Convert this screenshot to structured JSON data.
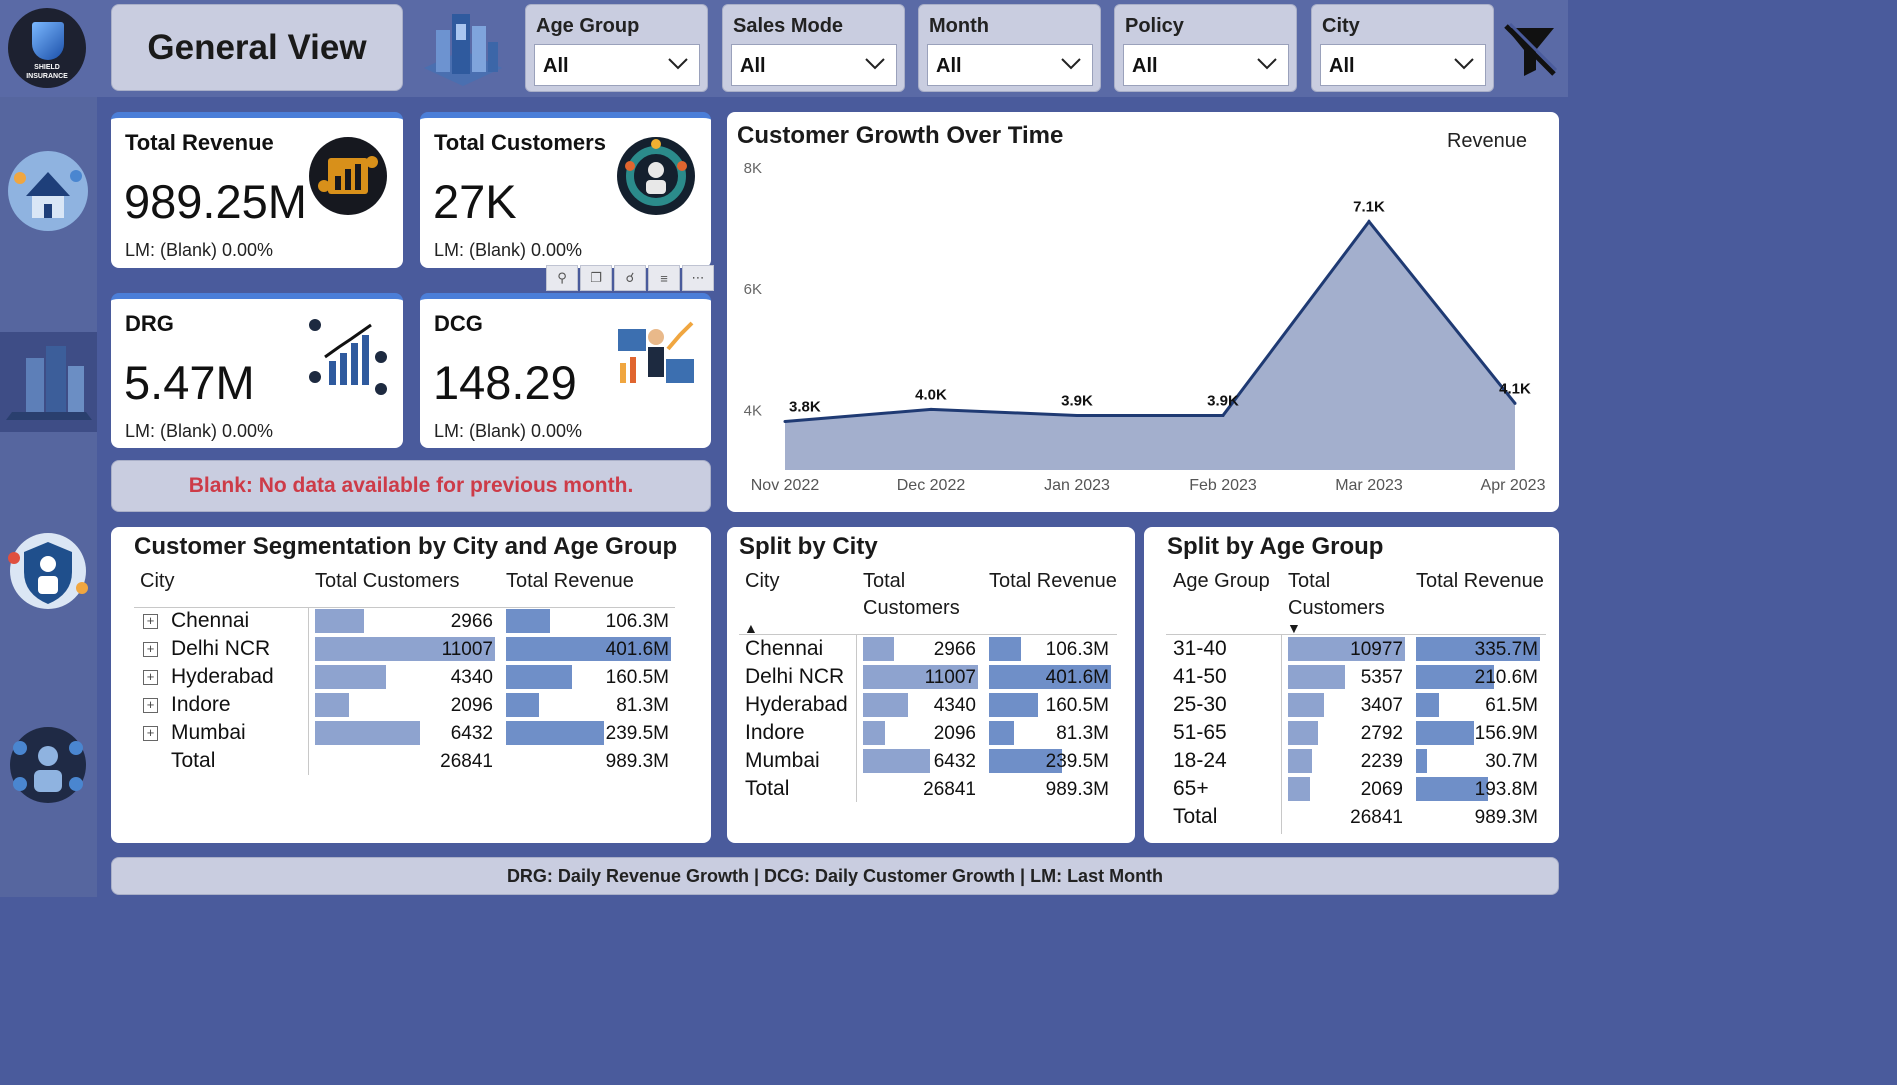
{
  "logo": {
    "line1": "SHIELD",
    "line2": "INSURANCE"
  },
  "header": {
    "title": "General View"
  },
  "slicers": [
    {
      "label": "Age Group",
      "value": "All"
    },
    {
      "label": "Sales Mode",
      "value": "All"
    },
    {
      "label": "Month",
      "value": "All"
    },
    {
      "label": "Policy",
      "value": "All"
    },
    {
      "label": "City",
      "value": "All"
    }
  ],
  "kpis": [
    {
      "title": "Total Revenue",
      "value": "989.25M",
      "lm": "LM: (Blank) 0.00%"
    },
    {
      "title": "Total Customers",
      "value": "27K",
      "lm": "LM: (Blank) 0.00%"
    },
    {
      "title": "DRG",
      "value": "5.47M",
      "lm": "LM: (Blank) 0.00%"
    },
    {
      "title": "DCG",
      "value": "148.29",
      "lm": "LM: (Blank) 0.00%"
    }
  ],
  "visual_toolbar": [
    "pin-icon",
    "copy-icon",
    "bell-icon",
    "filter-icon",
    "more-icon"
  ],
  "note": "Blank: No data available for previous month.",
  "footer": "DRG: Daily Revenue Growth | DCG: Daily Customer Growth | LM: Last Month",
  "chart_data": {
    "type": "area",
    "title": "Customer Growth Over Time",
    "legend": "Revenue",
    "legend_position": "top-right",
    "x": [
      "Nov 2022",
      "Dec 2022",
      "Jan 2023",
      "Feb 2023",
      "Mar 2023",
      "Apr 2023"
    ],
    "values": [
      3.8,
      4.0,
      3.9,
      3.9,
      7.1,
      4.1
    ],
    "data_labels": [
      "3.8K",
      "4.0K",
      "3.9K",
      "3.9K",
      "7.1K",
      "4.1K"
    ],
    "y_ticks": [
      "4K",
      "6K",
      "8K"
    ],
    "ylim": [
      3.0,
      8.0
    ],
    "color": "#1f3a73",
    "fill": "#a3afcd"
  },
  "segmentation": {
    "title": "Customer Segmentation by City and Age Group",
    "headers": [
      "City",
      "Total Customers",
      "Total Revenue"
    ],
    "max_customers": 11007,
    "max_revenue": 401.6,
    "rows": [
      {
        "city": "Chennai",
        "customers": "2966",
        "revenue": "106.3M",
        "c": 2966,
        "r": 106.3
      },
      {
        "city": "Delhi NCR",
        "customers": "11007",
        "revenue": "401.6M",
        "c": 11007,
        "r": 401.6
      },
      {
        "city": "Hyderabad",
        "customers": "4340",
        "revenue": "160.5M",
        "c": 4340,
        "r": 160.5
      },
      {
        "city": "Indore",
        "customers": "2096",
        "revenue": "81.3M",
        "c": 2096,
        "r": 81.3
      },
      {
        "city": "Mumbai",
        "customers": "6432",
        "revenue": "239.5M",
        "c": 6432,
        "r": 239.5
      }
    ],
    "total": {
      "label": "Total",
      "customers": "26841",
      "revenue": "989.3M"
    }
  },
  "split_city": {
    "title": "Split by City",
    "headers": [
      "City",
      "Total Customers",
      "Total Revenue"
    ],
    "max_customers": 11007,
    "max_revenue": 401.6,
    "rows": [
      {
        "city": "Chennai",
        "customers": "2966",
        "revenue": "106.3M",
        "c": 2966,
        "r": 106.3
      },
      {
        "city": "Delhi NCR",
        "customers": "11007",
        "revenue": "401.6M",
        "c": 11007,
        "r": 401.6
      },
      {
        "city": "Hyderabad",
        "customers": "4340",
        "revenue": "160.5M",
        "c": 4340,
        "r": 160.5
      },
      {
        "city": "Indore",
        "customers": "2096",
        "revenue": "81.3M",
        "c": 2096,
        "r": 81.3
      },
      {
        "city": "Mumbai",
        "customers": "6432",
        "revenue": "239.5M",
        "c": 6432,
        "r": 239.5
      }
    ],
    "total": {
      "label": "Total",
      "customers": "26841",
      "revenue": "989.3M"
    }
  },
  "split_age": {
    "title": "Split by Age Group",
    "headers": [
      "Age Group",
      "Total Customers",
      "Total Revenue"
    ],
    "max_customers": 10977,
    "max_revenue": 335.7,
    "rows": [
      {
        "city": "31-40",
        "customers": "10977",
        "revenue": "335.7M",
        "c": 10977,
        "r": 335.7
      },
      {
        "city": "41-50",
        "customers": "5357",
        "revenue": "210.6M",
        "c": 5357,
        "r": 210.6
      },
      {
        "city": "25-30",
        "customers": "3407",
        "revenue": "61.5M",
        "c": 3407,
        "r": 61.5
      },
      {
        "city": "51-65",
        "customers": "2792",
        "revenue": "156.9M",
        "c": 2792,
        "r": 156.9
      },
      {
        "city": "18-24",
        "customers": "2239",
        "revenue": "30.7M",
        "c": 2239,
        "r": 30.7
      },
      {
        "city": "65+",
        "customers": "2069",
        "revenue": "193.8M",
        "c": 2069,
        "r": 193.8
      }
    ],
    "total": {
      "label": "Total",
      "customers": "26841",
      "revenue": "989.3M"
    }
  }
}
